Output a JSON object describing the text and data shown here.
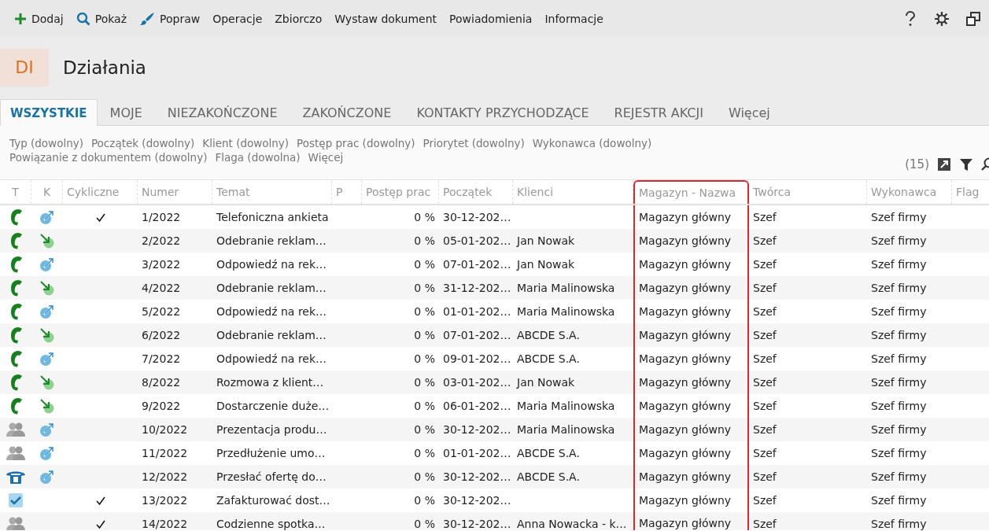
{
  "toolbar": {
    "items": [
      {
        "label": "Dodaj"
      },
      {
        "label": "Pokaż"
      },
      {
        "label": "Popraw"
      },
      {
        "label": "Operacje"
      },
      {
        "label": "Zbiorczo"
      },
      {
        "label": "Wystaw dokument"
      },
      {
        "label": "Powiadomienia"
      },
      {
        "label": "Informacje"
      }
    ]
  },
  "header": {
    "badge": "DI",
    "title": "Działania"
  },
  "tabs": [
    {
      "label": "WSZYSTKIE",
      "selected": true
    },
    {
      "label": "MOJE",
      "selected": false
    },
    {
      "label": "NIEZAKOŃCZONE",
      "selected": false
    },
    {
      "label": "ZAKOŃCZONE",
      "selected": false
    },
    {
      "label": "KONTAKTY PRZYCHODZĄCE",
      "selected": false
    },
    {
      "label": "REJESTR AKCJI",
      "selected": false
    },
    {
      "label": "Więcej",
      "selected": false
    }
  ],
  "filters": [
    "Typ (dowolny)",
    "Początek (dowolny)",
    "Klient (dowolny)",
    "Postęp prac (dowolny)",
    "Priorytet (dowolny)",
    "Wykonawca (dowolny)",
    "Powiązanie z dokumentem (dowolny)",
    "Flaga (dowolna)",
    "Więcej"
  ],
  "count": "(15)",
  "table": {
    "columns": [
      {
        "label": "T",
        "highlighted": false
      },
      {
        "label": "K",
        "highlighted": false
      },
      {
        "label": "Cykliczne",
        "highlighted": false
      },
      {
        "label": "Numer",
        "highlighted": false
      },
      {
        "label": "Temat",
        "highlighted": false
      },
      {
        "label": "P",
        "highlighted": false
      },
      {
        "label": "Postęp prac",
        "highlighted": false
      },
      {
        "label": "Początek",
        "highlighted": false
      },
      {
        "label": "Klienci",
        "highlighted": false
      },
      {
        "label": "Magazyn - Nazwa",
        "highlighted": true
      },
      {
        "label": "Twórca",
        "highlighted": false
      },
      {
        "label": "Wykonawca",
        "highlighted": false
      },
      {
        "label": "Flag",
        "highlighted": false
      }
    ],
    "rows": [
      {
        "kind": "phone",
        "outgoing": true,
        "incoming": false,
        "cyclic": true,
        "number": "1/2022",
        "subject": "Telefoniczna ankieta",
        "progress": "0 %",
        "start": "30-12-202…",
        "client": "",
        "warehouse": "Magazyn główny",
        "creator": "Szef",
        "assignee": "Szef firmy"
      },
      {
        "kind": "phone",
        "outgoing": false,
        "incoming": true,
        "cyclic": false,
        "number": "2/2022",
        "subject": "Odebranie reklam…",
        "progress": "0 %",
        "start": "05-01-202…",
        "client": "Jan Nowak",
        "warehouse": "Magazyn główny",
        "creator": "Szef",
        "assignee": "Szef firmy"
      },
      {
        "kind": "phone",
        "outgoing": true,
        "incoming": false,
        "cyclic": false,
        "number": "3/2022",
        "subject": "Odpowiedź na rek…",
        "progress": "0 %",
        "start": "07-01-202…",
        "client": "Jan Nowak",
        "warehouse": "Magazyn główny",
        "creator": "Szef",
        "assignee": "Szef firmy"
      },
      {
        "kind": "phone",
        "outgoing": false,
        "incoming": true,
        "cyclic": false,
        "number": "4/2022",
        "subject": "Odebranie reklam…",
        "progress": "0 %",
        "start": "31-12-202…",
        "client": "Maria Malinowska",
        "warehouse": "Magazyn główny",
        "creator": "Szef",
        "assignee": "Szef firmy"
      },
      {
        "kind": "phone",
        "outgoing": true,
        "incoming": false,
        "cyclic": false,
        "number": "5/2022",
        "subject": "Odpowiedź na rek…",
        "progress": "0 %",
        "start": "01-01-202…",
        "client": "Maria Malinowska",
        "warehouse": "Magazyn główny",
        "creator": "Szef",
        "assignee": "Szef firmy"
      },
      {
        "kind": "phone",
        "outgoing": false,
        "incoming": true,
        "cyclic": false,
        "number": "6/2022",
        "subject": "Odebranie reklam…",
        "progress": "0 %",
        "start": "07-01-202…",
        "client": "ABCDE S.A.",
        "warehouse": "Magazyn główny",
        "creator": "Szef",
        "assignee": "Szef firmy"
      },
      {
        "kind": "phone",
        "outgoing": true,
        "incoming": false,
        "cyclic": false,
        "number": "7/2022",
        "subject": "Odpowiedź na rek…",
        "progress": "0 %",
        "start": "09-01-202…",
        "client": "ABCDE S.A.",
        "warehouse": "Magazyn główny",
        "creator": "Szef",
        "assignee": "Szef firmy"
      },
      {
        "kind": "phone",
        "outgoing": false,
        "incoming": true,
        "cyclic": false,
        "number": "8/2022",
        "subject": "Rozmowa z klient…",
        "progress": "0 %",
        "start": "03-01-202…",
        "client": "Jan Nowak",
        "warehouse": "Magazyn główny",
        "creator": "Szef",
        "assignee": "Szef firmy"
      },
      {
        "kind": "phone",
        "outgoing": false,
        "incoming": true,
        "cyclic": false,
        "number": "9/2022",
        "subject": "Dostarczenie duże…",
        "progress": "0 %",
        "start": "06-01-202…",
        "client": "Maria Malinowska",
        "warehouse": "Magazyn główny",
        "creator": "Szef",
        "assignee": "Szef firmy"
      },
      {
        "kind": "meeting",
        "outgoing": true,
        "incoming": false,
        "cyclic": false,
        "number": "10/2022",
        "subject": "Prezentacja produ…",
        "progress": "0 %",
        "start": "30-12-202…",
        "client": "Maria Malinowska",
        "warehouse": "Magazyn główny",
        "creator": "Szef",
        "assignee": "Szef firmy"
      },
      {
        "kind": "meeting",
        "outgoing": true,
        "incoming": false,
        "cyclic": false,
        "number": "11/2022",
        "subject": "Przedłużenie umo…",
        "progress": "0 %",
        "start": "01-01-202…",
        "client": "ABCDE S.A.",
        "warehouse": "Magazyn główny",
        "creator": "Szef",
        "assignee": "Szef firmy"
      },
      {
        "kind": "fax",
        "outgoing": true,
        "incoming": false,
        "cyclic": false,
        "number": "12/2022",
        "subject": "Przesłać ofertę do…",
        "progress": "0 %",
        "start": "30-12-202…",
        "client": "ABCDE S.A.",
        "warehouse": "Magazyn główny",
        "creator": "Szef",
        "assignee": "Szef firmy"
      },
      {
        "kind": "task",
        "outgoing": false,
        "incoming": false,
        "cyclic": true,
        "number": "13/2022",
        "subject": "Zafakturować dost…",
        "progress": "0 %",
        "start": "30-12-202…",
        "client": "",
        "warehouse": "Magazyn główny",
        "creator": "Szef",
        "assignee": "Szef firmy"
      },
      {
        "kind": "meeting",
        "outgoing": false,
        "incoming": false,
        "cyclic": true,
        "number": "14/2022",
        "subject": "Codzienne spotka…",
        "progress": "0 %",
        "start": "30-12-202…",
        "client": "Anna Nowacka - k…",
        "warehouse": "Magazyn główny",
        "creator": "Szef",
        "assignee": "Szef firmy"
      }
    ]
  }
}
